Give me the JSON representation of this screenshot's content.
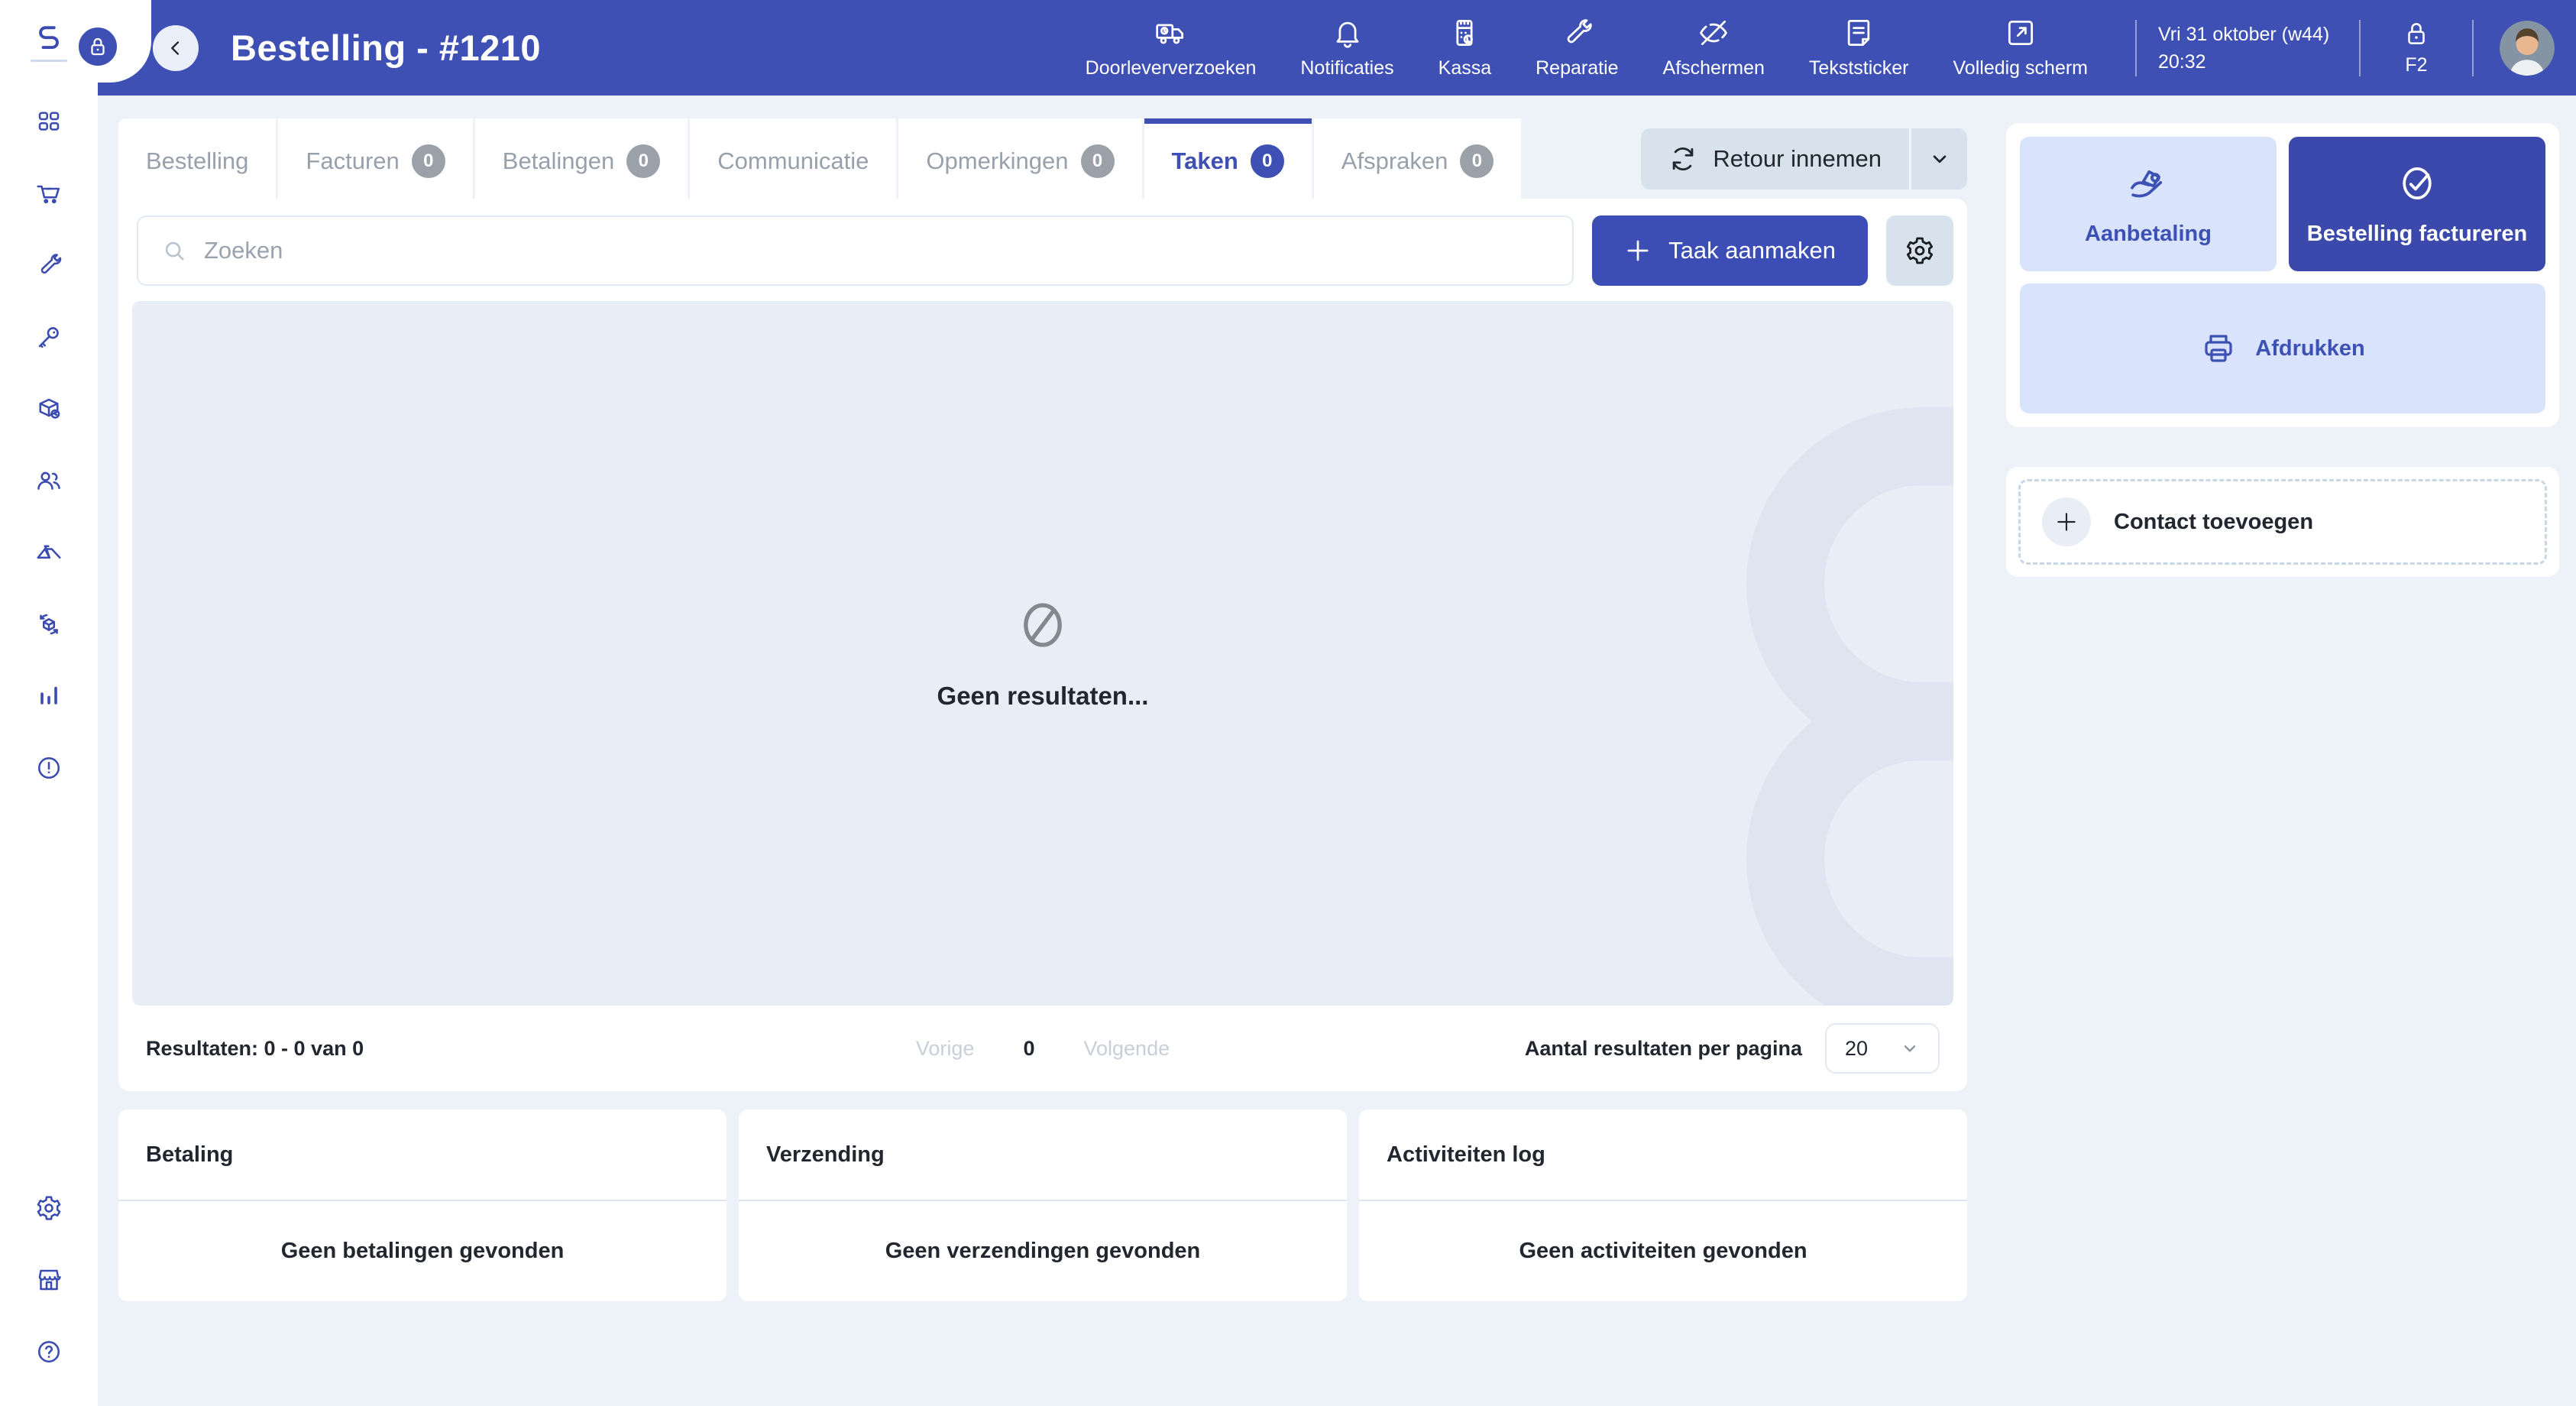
{
  "header": {
    "title": "Bestelling - #1210",
    "actions": [
      {
        "label": "Doorleververzoeken"
      },
      {
        "label": "Notificaties"
      },
      {
        "label": "Kassa"
      },
      {
        "label": "Reparatie"
      },
      {
        "label": "Afschermen"
      },
      {
        "label": "Tekststicker"
      },
      {
        "label": "Volledig scherm"
      }
    ],
    "date_line": "Vri 31 oktober (w44)",
    "time": "20:32",
    "lock_key": "F2"
  },
  "tabs": [
    {
      "label": "Bestelling"
    },
    {
      "label": "Facturen",
      "badge": "0"
    },
    {
      "label": "Betalingen",
      "badge": "0"
    },
    {
      "label": "Communicatie"
    },
    {
      "label": "Opmerkingen",
      "badge": "0"
    },
    {
      "label": "Taken",
      "badge": "0"
    },
    {
      "label": "Afspraken",
      "badge": "0"
    }
  ],
  "toolbar": {
    "retour_button": "Retour innemen",
    "search_placeholder": "Zoeken",
    "create_task_button": "Taak aanmaken"
  },
  "results": {
    "empty_text": "Geen resultaten...",
    "summary": "Resultaten: 0 - 0 van 0",
    "prev_label": "Vorige",
    "current_page": "0",
    "next_label": "Volgende",
    "per_page_label": "Aantal resultaten per pagina",
    "per_page_value": "20"
  },
  "actions_panel": {
    "deposit_button": "Aanbetaling",
    "invoice_button": "Bestelling factureren",
    "print_button": "Afdrukken",
    "add_contact_button": "Contact toevoegen"
  },
  "bottom_cards": [
    {
      "title": "Betaling",
      "empty_text": "Geen betalingen gevonden"
    },
    {
      "title": "Verzending",
      "empty_text": "Geen verzendingen gevonden"
    },
    {
      "title": "Activiteiten log",
      "empty_text": "Geen activiteiten gevonden"
    }
  ],
  "colors": {
    "brand": "#3e50b4",
    "brand_dark": "#3a49ab",
    "lavender": "#d9e3fb",
    "page_bg": "#edf1f8"
  }
}
